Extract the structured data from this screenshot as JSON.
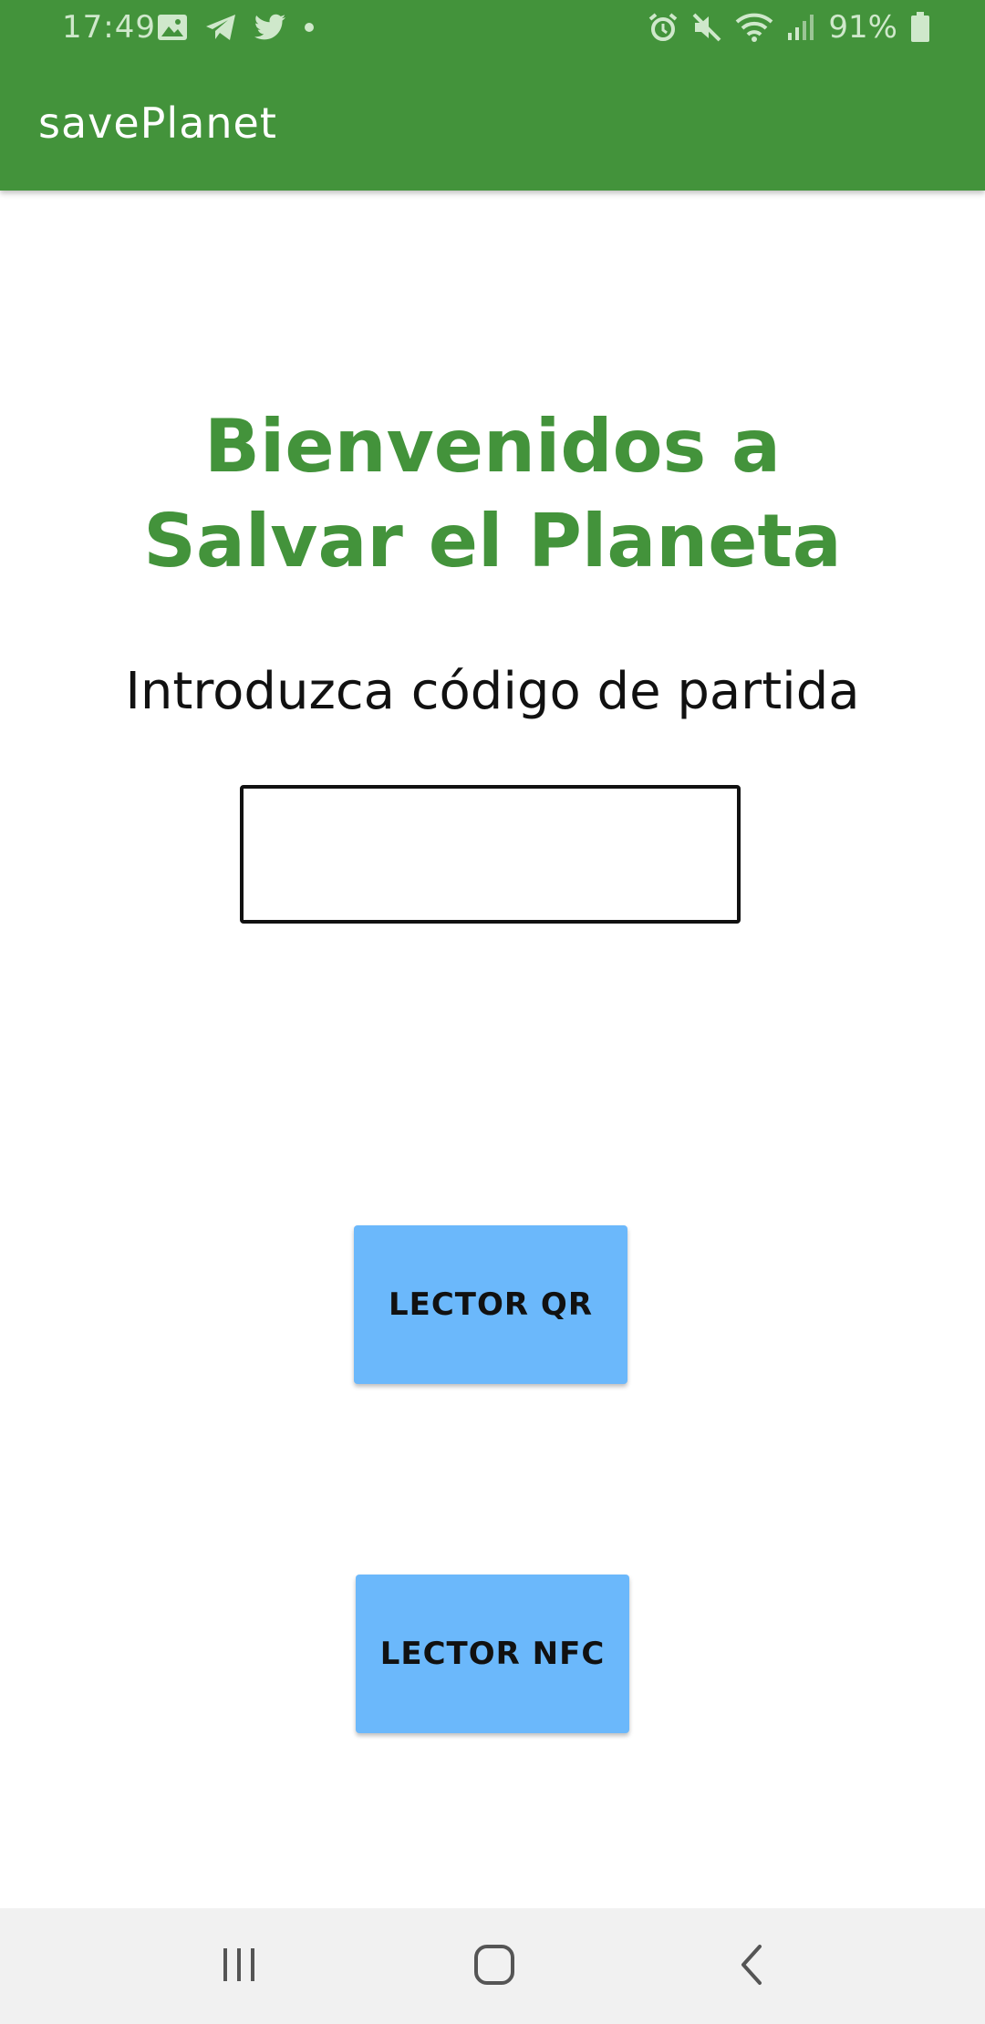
{
  "status_bar": {
    "time": "17:49",
    "battery": "91%",
    "icons_left": [
      "image-icon",
      "telegram-icon",
      "twitter-icon",
      "dot-icon"
    ],
    "icons_right": [
      "alarm-icon",
      "mute-icon",
      "wifi-icon",
      "signal-icon",
      "battery-icon"
    ]
  },
  "app_bar": {
    "title": "savePlanet"
  },
  "main": {
    "welcome_title": "Bienvenidos a Salvar el Planeta",
    "prompt_label": "Introduzca código de partida",
    "code_input": {
      "value": "",
      "placeholder": ""
    },
    "qr_button_label": "LECTOR QR",
    "nfc_button_label": "LECTOR NFC"
  },
  "nav_bar": {
    "buttons": [
      "recents-icon",
      "home-icon",
      "back-icon"
    ]
  },
  "colors": {
    "primary": "#43933b",
    "button": "#6bb8fb",
    "navbar": "#f1f1f1"
  }
}
